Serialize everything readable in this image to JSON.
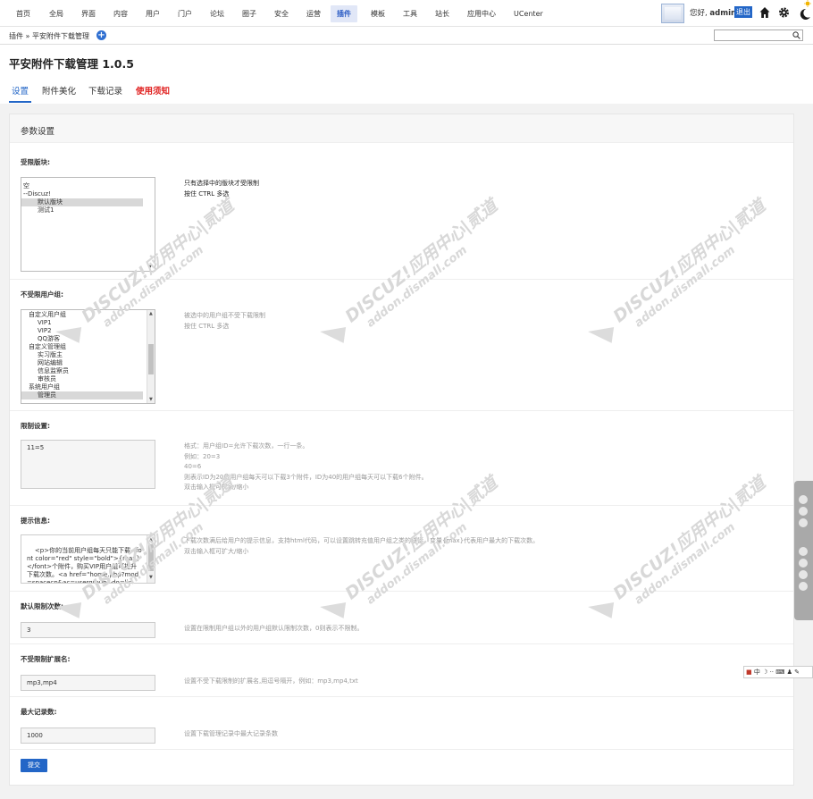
{
  "nav": {
    "items": [
      "首页",
      "全局",
      "界面",
      "内容",
      "用户",
      "门户",
      "论坛",
      "圈子",
      "安全",
      "运营",
      "插件",
      "模板",
      "工具",
      "站长",
      "应用中心",
      "UCenter"
    ],
    "active_index": 10,
    "greeting": "您好,",
    "username": "admin",
    "logout": "退出"
  },
  "breadcrumb": "插件 » 平安附件下载管理",
  "page": {
    "title": "平安附件下载管理 1.0.5",
    "tabs": [
      "设置",
      "附件美化",
      "下载记录",
      "使用须知"
    ]
  },
  "panel_title": "参数设置",
  "fields": {
    "forums": {
      "label": "受限版块:",
      "options": [
        "空",
        "--Discuz!",
        "默认版块",
        "测试1"
      ],
      "tip1": "只有选择中的版块才受限制",
      "tip2": "按住 CTRL 多选"
    },
    "groups": {
      "label": "不受限用户组:",
      "options": [
        "自定义用户组",
        "VIP1",
        "VIP2",
        "QQ游客",
        "自定义管理组",
        "实习版主",
        "网站编辑",
        "信息监察员",
        "审核员",
        "系统用户组",
        "管理员"
      ],
      "tip1": "被选中的用户组不受下载限制",
      "tip2": "按住 CTRL 多选"
    },
    "limits": {
      "label": "限制设置:",
      "value": "11=5",
      "tips": [
        "格式：用户组ID=允许下载次数，一行一条。",
        "例如：20=3",
        "40=6",
        "则表示ID为20的用户组每天可以下载3个附件，ID为40的用户组每天可以下载6个附件。",
        "双击输入框可扩大/缩小"
      ]
    },
    "message": {
      "label": "提示信息:",
      "value": "<p>你的当前用户组每天只能下载<font color=\"red\" style=\"bold\">{max}</font>个附件，购买VIP用户组可提升下载次数。<a href=\"home.php?mod=spacecp&ac=usergroup&do=list\">点此购买</a></p>",
      "tip1": "下载次数满后给用户的提示信息，支持html代码，可以设置跳转充值用户组之类的链接。变量{max}代表用户最大的下载次数。",
      "tip2": "双击输入框可扩大/缩小"
    },
    "default_limit": {
      "label": "默认限制次数:",
      "value": "3",
      "tip": "设置在限制用户组以外的用户组默认限制次数，0则表示不限制。"
    },
    "ext": {
      "label": "不受限制扩展名:",
      "value": "mp3,mp4",
      "tip": "设置不受下载限制的扩展名,用逗号隔开，例如：mp3,mp4,txt"
    },
    "max_records": {
      "label": "最大记录数:",
      "value": "1000",
      "tip": "设置下载管理记录中最大记录条数"
    }
  },
  "submit": "提交",
  "watermark": {
    "line1": "DISCUZ!应用中心|贰道",
    "line2": "addon.dismall.com"
  },
  "ime": "中"
}
